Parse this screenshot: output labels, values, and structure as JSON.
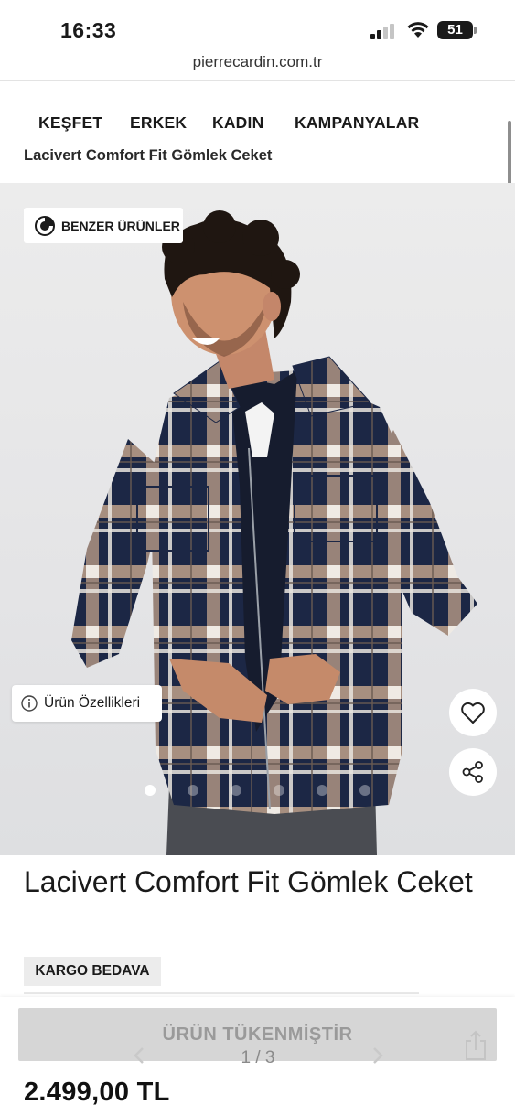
{
  "status_bar": {
    "time": "16:33",
    "battery": "51",
    "icons": [
      "signal-icon",
      "wifi-icon",
      "battery-icon"
    ]
  },
  "browser": {
    "url": "pierrecardin.com.tr"
  },
  "nav": {
    "items": [
      {
        "label": "KEŞFET"
      },
      {
        "label": "ERKEK"
      },
      {
        "label": "KADIN"
      },
      {
        "label": "KAMPANYALAR"
      }
    ]
  },
  "breadcrumb": {
    "title": "Lacivert Comfort Fit Gömlek Ceket"
  },
  "gallery": {
    "benzer_label": "BENZER ÜRÜNLER",
    "ozellik_label": "Ürün Özellikleri",
    "current_index": 1,
    "dot_count": 6,
    "icons": [
      "heart-icon",
      "share-icon",
      "info-icon",
      "similar-products-icon"
    ]
  },
  "product": {
    "title": "Lacivert Comfort Fit Gömlek Ceket",
    "badge": "KARGO BEDAVA",
    "price": "2.499,00 TL",
    "button_label": "ÜRÜN TÜKENMİŞTİR"
  },
  "browser_toolbar": {
    "pager": "1 / 3"
  },
  "colors": {
    "navy": "#1c2745",
    "beige": "#b69a86",
    "button_gray": "#d6d6d6",
    "badge_gray": "#ececec"
  }
}
